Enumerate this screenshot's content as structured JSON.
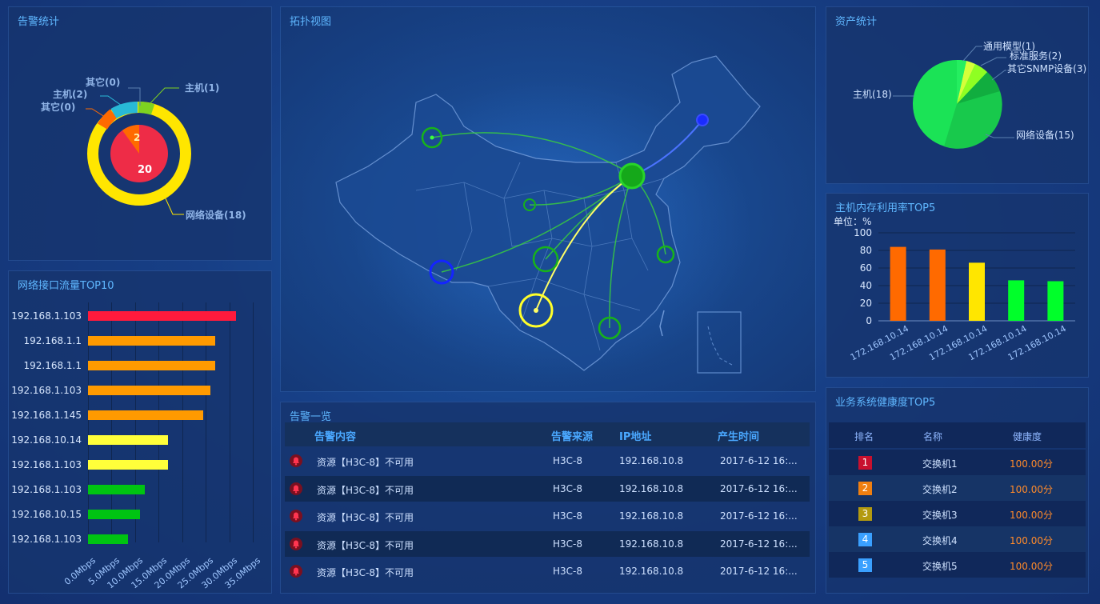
{
  "alarm_stats": {
    "title": "告警统计",
    "labels": {
      "other_top": "其它(0)",
      "host_left": "主机(2)",
      "other_left": "其它(0)",
      "host_right": "主机(1)",
      "network": "网络设备(18)"
    },
    "inner_values": [
      "2",
      "20"
    ]
  },
  "traffic": {
    "title": "网络接口流量TOP10",
    "rows": [
      {
        "ip": "192.168.1.103",
        "value": 31.5,
        "color": "#ff1a3c"
      },
      {
        "ip": "192.168.1.1",
        "value": 27.0,
        "color": "#ff9a00"
      },
      {
        "ip": "192.168.1.1",
        "value": 27.0,
        "color": "#ff9a00"
      },
      {
        "ip": "192.168.1.103",
        "value": 26.0,
        "color": "#ff9a00"
      },
      {
        "ip": "192.168.1.145",
        "value": 24.5,
        "color": "#ff9a00"
      },
      {
        "ip": "192.168.10.14",
        "value": 17.0,
        "color": "#ffff3a"
      },
      {
        "ip": "192.168.1.103",
        "value": 17.0,
        "color": "#ffff3a"
      },
      {
        "ip": "192.168.1.103",
        "value": 12.0,
        "color": "#00c412"
      },
      {
        "ip": "192.168.10.15",
        "value": 11.0,
        "color": "#00c412"
      },
      {
        "ip": "192.168.1.103",
        "value": 8.5,
        "color": "#00c412"
      }
    ],
    "xticks": [
      "0.0Mbps",
      "5.0Mbps",
      "10.0Mbps",
      "15.0Mbps",
      "20.0Mbps",
      "25.0Mbps",
      "30.0Mbps",
      "35.0Mbps"
    ],
    "xmax": 35
  },
  "topology": {
    "title": "拓扑视图"
  },
  "alarms": {
    "title": "告警一览",
    "headers": {
      "content": "告警内容",
      "source": "告警来源",
      "ip": "IP地址",
      "time": "产生时间"
    },
    "rows": [
      {
        "content": "资源【H3C-8】不可用",
        "source": "H3C-8",
        "ip": "192.168.10.8",
        "time": "2017-6-12  16:..."
      },
      {
        "content": "资源【H3C-8】不可用",
        "source": "H3C-8",
        "ip": "192.168.10.8",
        "time": "2017-6-12  16:..."
      },
      {
        "content": "资源【H3C-8】不可用",
        "source": "H3C-8",
        "ip": "192.168.10.8",
        "time": "2017-6-12  16:..."
      },
      {
        "content": "资源【H3C-8】不可用",
        "source": "H3C-8",
        "ip": "192.168.10.8",
        "time": "2017-6-12  16:..."
      },
      {
        "content": "资源【H3C-8】不可用",
        "source": "H3C-8",
        "ip": "192.168.10.8",
        "time": "2017-6-12  16:..."
      }
    ]
  },
  "assets": {
    "title": "资产统计",
    "labels": {
      "generic": "通用模型(1)",
      "service": "标准服务(2)",
      "snmp": "其它SNMP设备(3)",
      "host": "主机(18)",
      "network": "网络设备(15)"
    }
  },
  "memory": {
    "title": "主机内存利用率TOP5",
    "unit": "单位：%",
    "chart_data": {
      "type": "bar",
      "categories": [
        "172.168.10.14",
        "172.168.10.14",
        "172.168.10.14",
        "172.168.10.14",
        "172.168.10.14"
      ],
      "values": [
        84,
        81,
        66,
        46,
        45
      ],
      "colors": [
        "#ff6a00",
        "#ff6a00",
        "#ffe600",
        "#00ff2a",
        "#00ff2a"
      ],
      "ylim": [
        0,
        100
      ],
      "yticks": [
        "0",
        "20",
        "40",
        "60",
        "80",
        "100"
      ]
    }
  },
  "health": {
    "title": "业务系统健康度TOP5",
    "headers": {
      "rank": "排名",
      "name": "名称",
      "score": "健康度"
    },
    "rows": [
      {
        "rank": "1",
        "name": "交换机1",
        "score": "100.00分",
        "color": "#c8102e"
      },
      {
        "rank": "2",
        "name": "交换机2",
        "score": "100.00分",
        "color": "#f07f10"
      },
      {
        "rank": "3",
        "name": "交换机3",
        "score": "100.00分",
        "color": "#b39a10"
      },
      {
        "rank": "4",
        "name": "交换机4",
        "score": "100.00分",
        "color": "#3aa0ff"
      },
      {
        "rank": "5",
        "name": "交换机5",
        "score": "100.00分",
        "color": "#3aa0ff"
      }
    ]
  }
}
